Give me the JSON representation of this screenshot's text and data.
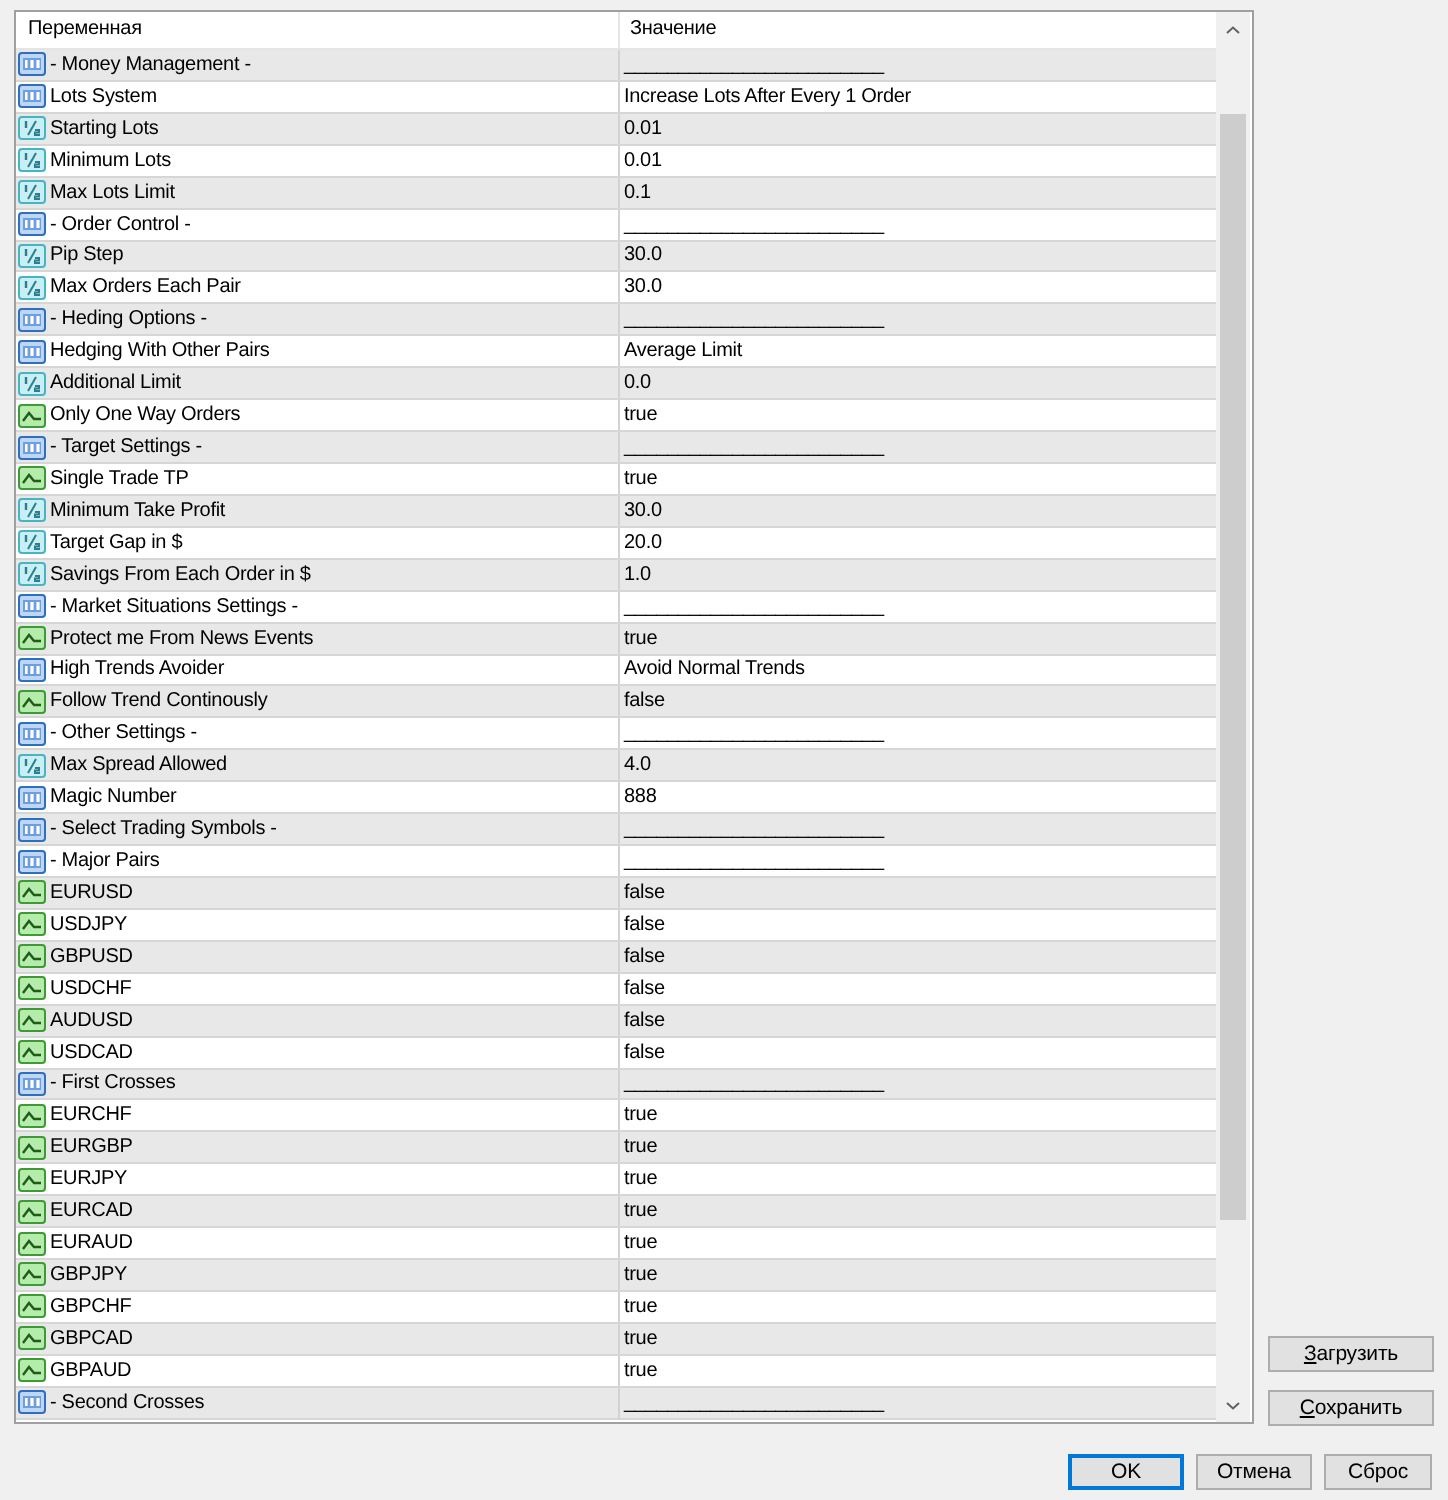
{
  "table": {
    "columns": [
      "Переменная",
      "Значение"
    ],
    "rows": [
      {
        "name": "- Money Management -",
        "value": "________________________",
        "kind": "int"
      },
      {
        "name": "Lots System",
        "value": "Increase Lots After Every 1 Order",
        "kind": "int"
      },
      {
        "name": "Starting Lots",
        "value": "0.01",
        "kind": "double"
      },
      {
        "name": "Minimum Lots",
        "value": "0.01",
        "kind": "double"
      },
      {
        "name": "Max Lots Limit",
        "value": "0.1",
        "kind": "double"
      },
      {
        "name": "- Order Control -",
        "value": "________________________",
        "kind": "int"
      },
      {
        "name": "Pip Step",
        "value": "30.0",
        "kind": "double"
      },
      {
        "name": "Max Orders Each Pair",
        "value": "30.0",
        "kind": "double"
      },
      {
        "name": "- Heding Options -",
        "value": "________________________",
        "kind": "int"
      },
      {
        "name": "Hedging With Other Pairs",
        "value": "Average Limit",
        "kind": "int"
      },
      {
        "name": "Additional Limit",
        "value": "0.0",
        "kind": "double"
      },
      {
        "name": "Only One Way Orders",
        "value": "true",
        "kind": "bool"
      },
      {
        "name": "- Target Settings -",
        "value": "________________________",
        "kind": "int"
      },
      {
        "name": "Single Trade TP",
        "value": "true",
        "kind": "bool"
      },
      {
        "name": "Minimum Take Profit",
        "value": "30.0",
        "kind": "double"
      },
      {
        "name": "Target Gap in $",
        "value": "20.0",
        "kind": "double"
      },
      {
        "name": "Savings From Each Order in $",
        "value": "1.0",
        "kind": "double"
      },
      {
        "name": "- Market Situations Settings -",
        "value": "________________________",
        "kind": "int"
      },
      {
        "name": "Protect me From News Events",
        "value": "true",
        "kind": "bool"
      },
      {
        "name": "High Trends Avoider",
        "value": "Avoid Normal Trends",
        "kind": "int"
      },
      {
        "name": "Follow Trend Continously",
        "value": "false",
        "kind": "bool"
      },
      {
        "name": "- Other Settings -",
        "value": "________________________",
        "kind": "int"
      },
      {
        "name": "Max Spread Allowed",
        "value": "4.0",
        "kind": "double"
      },
      {
        "name": "Magic Number",
        "value": "888",
        "kind": "int"
      },
      {
        "name": "- Select Trading Symbols -",
        "value": "________________________",
        "kind": "int"
      },
      {
        "name": "- Major Pairs",
        "value": "________________________",
        "kind": "int"
      },
      {
        "name": "EURUSD",
        "value": "false",
        "kind": "bool"
      },
      {
        "name": "USDJPY",
        "value": "false",
        "kind": "bool"
      },
      {
        "name": "GBPUSD",
        "value": "false",
        "kind": "bool"
      },
      {
        "name": "USDCHF",
        "value": "false",
        "kind": "bool"
      },
      {
        "name": "AUDUSD",
        "value": "false",
        "kind": "bool"
      },
      {
        "name": "USDCAD",
        "value": "false",
        "kind": "bool"
      },
      {
        "name": "- First Crosses",
        "value": "________________________",
        "kind": "int"
      },
      {
        "name": "EURCHF",
        "value": "true",
        "kind": "bool"
      },
      {
        "name": "EURGBP",
        "value": "true",
        "kind": "bool"
      },
      {
        "name": "EURJPY",
        "value": "true",
        "kind": "bool"
      },
      {
        "name": "EURCAD",
        "value": "true",
        "kind": "bool"
      },
      {
        "name": "EURAUD",
        "value": "true",
        "kind": "bool"
      },
      {
        "name": "GBPJPY",
        "value": "true",
        "kind": "bool"
      },
      {
        "name": "GBPCHF",
        "value": "true",
        "kind": "bool"
      },
      {
        "name": "GBPCAD",
        "value": "true",
        "kind": "bool"
      },
      {
        "name": "GBPAUD",
        "value": "true",
        "kind": "bool"
      },
      {
        "name": "- Second Crosses",
        "value": "________________________",
        "kind": "int"
      }
    ]
  },
  "side_buttons": [
    {
      "label": "Загрузить",
      "mnemonic_underlined": true
    },
    {
      "label": "Сохранить",
      "mnemonic_underlined": true
    }
  ],
  "dialog_buttons": [
    {
      "label": "OK",
      "default": true
    },
    {
      "label": "Отмена",
      "default": false
    },
    {
      "label": "Сброс",
      "default": false
    }
  ]
}
